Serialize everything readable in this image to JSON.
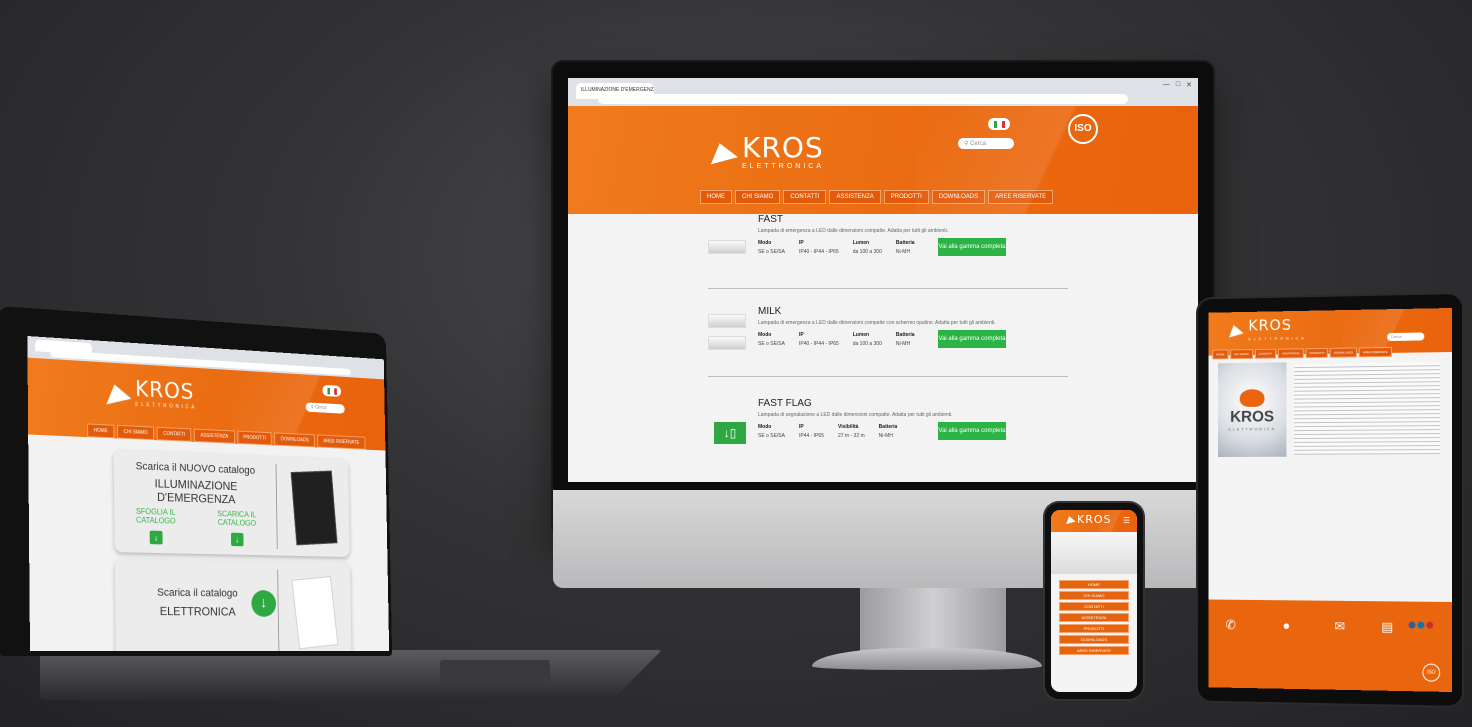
{
  "brand": {
    "name": "KROS",
    "tagline": "ELETTRONICA"
  },
  "colors": {
    "orange": "#ea6a10",
    "green": "#2cb345",
    "background": "#333335"
  },
  "iso_badge": "ISO",
  "nav": [
    "HOME",
    "CHI SIAMO",
    "CONTATTI",
    "ASSISTENZA",
    "PRODOTTI",
    "DOWNLOADS",
    "AREE RISERVATE"
  ],
  "search_placeholder": "Cerca",
  "imac": {
    "tab_title": "ILLUMINAZIONE D'EMERGENZA",
    "products": [
      {
        "name": "FAST",
        "description": "Lampada di emergenza a LED dalle dimensioni compatte. Adatta per tutti gli ambienti.",
        "col_headers": [
          "Modo",
          "IP",
          "Lumen",
          "Batteria"
        ],
        "col_values": [
          "SE o SE/SA",
          "IP40 - IP44 - IP65",
          "da 100 a 300",
          "Ni-MH"
        ],
        "button": "Vai alla gamma completa"
      },
      {
        "name": "MILK",
        "description": "Lampada di emergenza a LED dalle dimensioni compatte con schermo opalino. Adatta per tutti gli ambienti.",
        "col_headers": [
          "Modo",
          "IP",
          "Lumen",
          "Batteria"
        ],
        "col_values": [
          "SE o SE/SA",
          "IP40 - IP44 - IP65",
          "da 100 a 300",
          "Ni-MH"
        ],
        "button": "Vai alla gamma completa"
      },
      {
        "name": "FAST FLAG",
        "description": "Lampada di segnalazione a LED dalle dimensioni compatte. Adatta per tutti gli ambienti.",
        "col_headers": [
          "Modo",
          "IP",
          "Visibilità",
          "Batteria"
        ],
        "col_values": [
          "SE o SE/SA",
          "IP44 - IP65",
          "27 m - 32 m",
          "Ni-MH"
        ],
        "button": "Vai alla gamma completa"
      }
    ]
  },
  "laptop": {
    "card1": {
      "line1": "Scarica il NUOVO catalogo",
      "line2": "ILLUMINAZIONE D'EMERGENZA",
      "link_browse": "SFOGLIA IL CATALOGO",
      "link_download": "SCARICA IL CATALOGO"
    },
    "card2": {
      "line1": "Scarica il catalogo",
      "line2": "ELETTRONICA"
    }
  },
  "phone": {
    "menu": [
      "HOME",
      "CHI SIAMO",
      "CONTATTI",
      "ASSISTENZA",
      "PRODOTTI",
      "DOWNLOADS",
      "AREE RISERVATE"
    ]
  }
}
